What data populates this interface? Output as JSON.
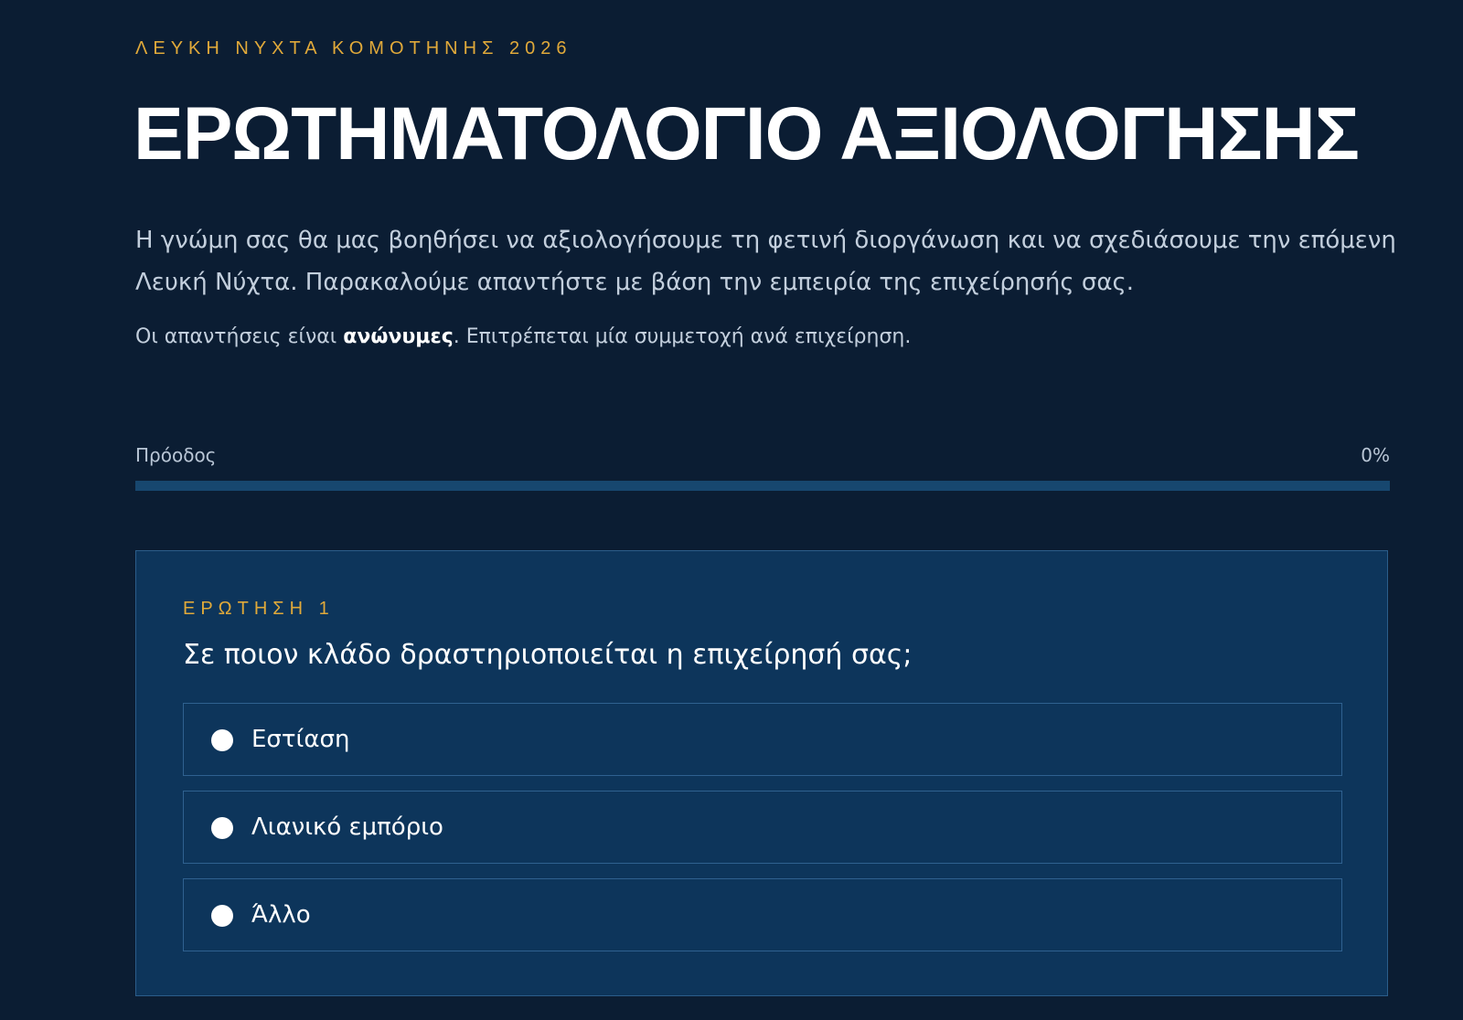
{
  "header": {
    "eyebrow": "ΛΕΥΚΗ ΝΥΧΤΑ ΚΟΜΟΤΗΝΗΣ 2026",
    "title": "ΕΡΩΤΗΜΑΤΟΛΟΓΙΟ ΑΞΙΟΛΟΓΗΣΗΣ"
  },
  "intro": {
    "text": "Η γνώμη σας θα μας βοηθήσει να αξιολογήσουμε τη φετινή διοργάνωση και να σχεδιάσουμε την επόμενη Λευκή Νύχτα. Παρακαλούμε απαντήστε με βάση την εμπειρία της επιχείρησής σας.",
    "note_before": "Οι απαντήσεις είναι ",
    "note_bold": "ανώνυμες",
    "note_after": ". Επιτρέπεται μία συμμετοχή ανά επιχείρηση."
  },
  "progress": {
    "label": "Πρόοδος",
    "value_text": "0%",
    "value": 0
  },
  "question": {
    "number_label": "ΕΡΩΤΗΣΗ 1",
    "text": "Σε ποιον κλάδο δραστηριοποιείται η επιχείρησή σας;",
    "options": [
      {
        "label": "Εστίαση"
      },
      {
        "label": "Λιανικό εμπόριο"
      },
      {
        "label": "Άλλο"
      }
    ]
  },
  "colors": {
    "background": "#0b1d33",
    "card": "#0d355b",
    "accent": "#e0a93a",
    "progress_track": "#17476f"
  }
}
